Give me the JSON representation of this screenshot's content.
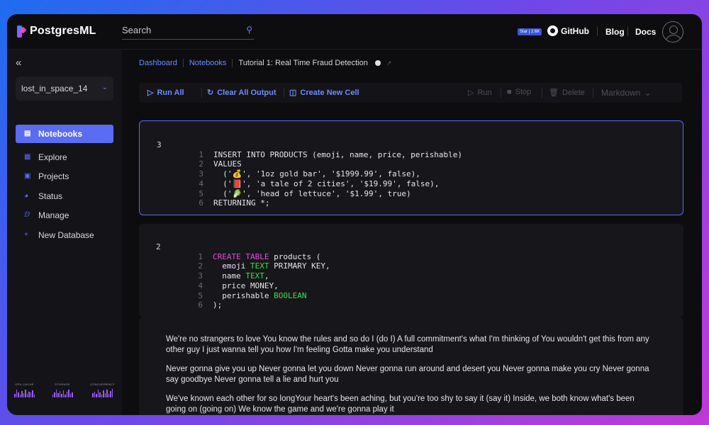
{
  "brand": {
    "name": "PostgresML"
  },
  "search": {
    "placeholder": "Search"
  },
  "topnav": {
    "star_badge": "Star | 2.6K",
    "github": "GitHub",
    "blog": "Blog",
    "docs": "Docs"
  },
  "sidebar": {
    "collapse": "«",
    "database": "lost_in_space_14",
    "items": [
      {
        "label": "Notebooks",
        "active": true
      },
      {
        "label": "Explore"
      },
      {
        "label": "Projects"
      },
      {
        "label": "Status"
      },
      {
        "label": "Manage"
      },
      {
        "label": "New Database"
      }
    ],
    "metrics": [
      {
        "label": "GPU CACHE",
        "levels": [
          0.45,
          0.9,
          0.6,
          0.3,
          0.75,
          0.5,
          0.95,
          0.4,
          0.7,
          0.55,
          0.85,
          0.35
        ]
      },
      {
        "label": "STORAGE",
        "levels": [
          0.35,
          0.6,
          0.9,
          0.5,
          0.75,
          0.4,
          0.85,
          0.3,
          0.65,
          0.95,
          0.45,
          0.55
        ]
      },
      {
        "label": "CONCURRENCY",
        "levels": [
          0.5,
          0.7,
          0.4,
          0.95,
          0.6,
          0.35,
          0.8,
          0.5,
          0.9,
          0.45,
          0.75,
          1.0
        ]
      }
    ]
  },
  "breadcrumb": {
    "dashboard": "Dashboard",
    "notebooks": "Notebooks",
    "current": "Tutorial 1: Real Time Fraud Detection"
  },
  "toolbar": {
    "run_all": "Run All",
    "clear_all": "Clear All Output",
    "create_cell": "Create New Cell",
    "run": "Run",
    "stop": "Stop",
    "delete": "Delete",
    "cell_type": "Markdown"
  },
  "cells": [
    {
      "exec_count": "3",
      "lines": [
        "INSERT INTO PRODUCTS (emoji, name, price, perishable)",
        "VALUES",
        "  ('💰', '1oz gold bar', '$1999.99', false),",
        "  ('📕', 'a tale of 2 cities', '$19.99', false),",
        "  ('🥬', 'head of lettuce', '$1.99', true)",
        "RETURNING *;"
      ]
    },
    {
      "exec_count": "2",
      "lines": [
        "CREATE TABLE products (",
        "  emoji TEXT PRIMARY KEY,",
        "  name TEXT,",
        "  price MONEY,",
        "  perishable BOOLEAN",
        ");"
      ]
    }
  ],
  "markdown": [
    "We're no strangers to love You know the rules and so do I (do I) A full commitment's what I'm thinking of You wouldn't get this from any other guy I just wanna tell you how I'm feeling Gotta make you understand",
    "Never gonna give you up Never gonna let you down Never gonna run around and desert you Never gonna make you cry Never gonna say goodbye Never gonna tell a lie and hurt you",
    "We've known each other for so longYour heart's been aching, but you're too shy to say it (say it) Inside, we both know what's been going on (going on) We know the game and we're gonna play it"
  ]
}
